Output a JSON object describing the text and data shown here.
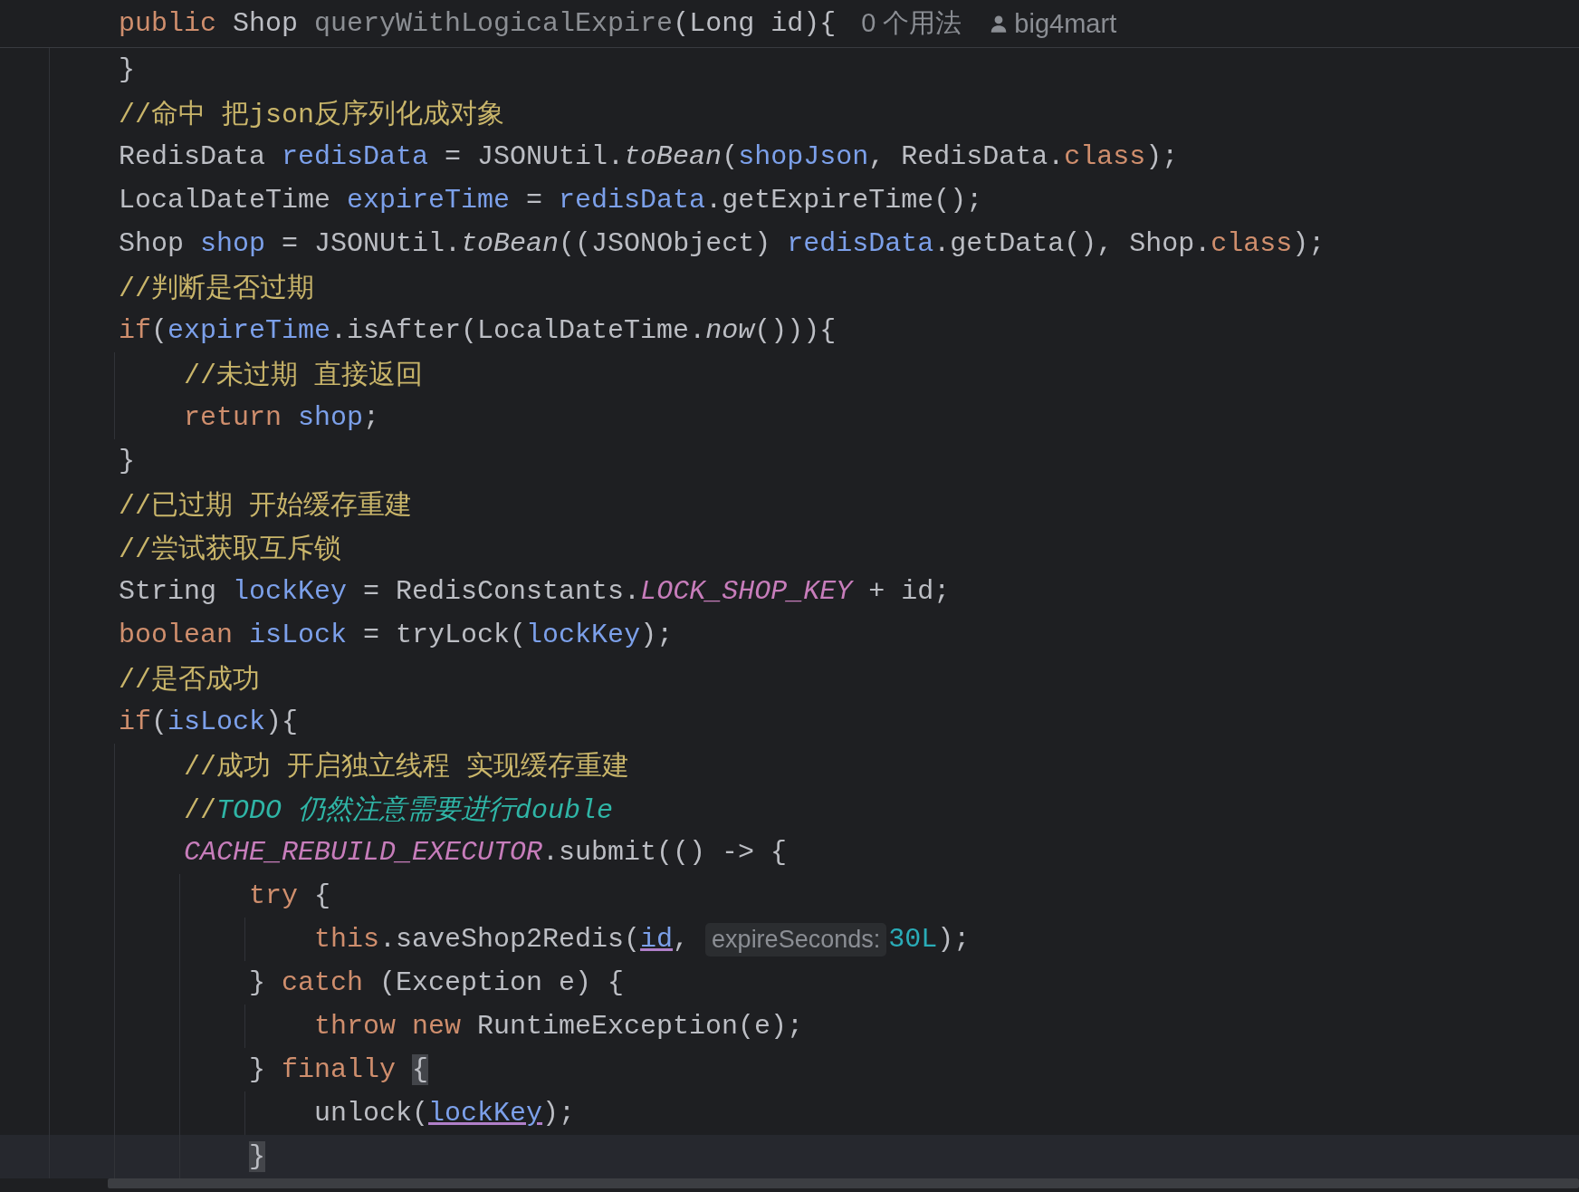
{
  "header": {
    "tokens": [
      {
        "kind": "keyword",
        "text": "public"
      },
      {
        "kind": "plain",
        "text": " Shop "
      },
      {
        "kind": "dim",
        "text": "queryWithLogicalExpire"
      },
      {
        "kind": "plain",
        "text": "(Long id){"
      }
    ],
    "usages": "0 个用法",
    "author": "big4mart"
  },
  "lines": [
    {
      "current": false,
      "tokens": [
        {
          "kind": "plain",
          "text": "}"
        }
      ]
    },
    {
      "current": false,
      "tokens": [
        {
          "kind": "comment",
          "text": "//命中 把json反序列化成对象"
        }
      ]
    },
    {
      "current": false,
      "tokens": [
        {
          "kind": "plain",
          "text": "RedisData "
        },
        {
          "kind": "variable",
          "text": "redisData"
        },
        {
          "kind": "plain",
          "text": " = JSONUtil."
        },
        {
          "kind": "static-call",
          "text": "toBean"
        },
        {
          "kind": "plain",
          "text": "("
        },
        {
          "kind": "variable",
          "text": "shopJson"
        },
        {
          "kind": "plain",
          "text": ", RedisData."
        },
        {
          "kind": "keyword",
          "text": "class"
        },
        {
          "kind": "plain",
          "text": ");"
        }
      ]
    },
    {
      "current": false,
      "tokens": [
        {
          "kind": "plain",
          "text": "LocalDateTime "
        },
        {
          "kind": "variable",
          "text": "expireTime"
        },
        {
          "kind": "plain",
          "text": " = "
        },
        {
          "kind": "variable",
          "text": "redisData"
        },
        {
          "kind": "plain",
          "text": ".getExpireTime();"
        }
      ]
    },
    {
      "current": false,
      "tokens": [
        {
          "kind": "plain",
          "text": "Shop "
        },
        {
          "kind": "variable",
          "text": "shop"
        },
        {
          "kind": "plain",
          "text": " = JSONUtil."
        },
        {
          "kind": "static-call",
          "text": "toBean"
        },
        {
          "kind": "plain",
          "text": "((JSONObject) "
        },
        {
          "kind": "variable",
          "text": "redisData"
        },
        {
          "kind": "plain",
          "text": ".getData(), Shop."
        },
        {
          "kind": "keyword",
          "text": "class"
        },
        {
          "kind": "plain",
          "text": ");"
        }
      ]
    },
    {
      "current": false,
      "tokens": [
        {
          "kind": "comment",
          "text": "//判断是否过期"
        }
      ]
    },
    {
      "current": false,
      "tokens": [
        {
          "kind": "keyword",
          "text": "if"
        },
        {
          "kind": "plain",
          "text": "("
        },
        {
          "kind": "variable",
          "text": "expireTime"
        },
        {
          "kind": "plain",
          "text": ".isAfter(LocalDateTime."
        },
        {
          "kind": "static-call",
          "text": "now"
        },
        {
          "kind": "plain",
          "text": "())){"
        }
      ],
      "children": [
        {
          "current": false,
          "tokens": [
            {
              "kind": "comment",
              "text": "//未过期 直接返回"
            }
          ]
        },
        {
          "current": false,
          "tokens": [
            {
              "kind": "keyword",
              "text": "return "
            },
            {
              "kind": "variable",
              "text": "shop"
            },
            {
              "kind": "plain",
              "text": ";"
            }
          ]
        }
      ]
    },
    {
      "current": false,
      "tokens": [
        {
          "kind": "plain",
          "text": "}"
        }
      ]
    },
    {
      "current": false,
      "tokens": [
        {
          "kind": "comment",
          "text": "//已过期 开始缓存重建"
        }
      ]
    },
    {
      "current": false,
      "tokens": [
        {
          "kind": "comment",
          "text": "//尝试获取互斥锁"
        }
      ]
    },
    {
      "current": false,
      "tokens": [
        {
          "kind": "plain",
          "text": "String "
        },
        {
          "kind": "variable",
          "text": "lockKey"
        },
        {
          "kind": "plain",
          "text": " = RedisConstants."
        },
        {
          "kind": "constant",
          "text": "LOCK_SHOP_KEY"
        },
        {
          "kind": "plain",
          "text": " + id;"
        }
      ]
    },
    {
      "current": false,
      "tokens": [
        {
          "kind": "keyword",
          "text": "boolean "
        },
        {
          "kind": "variable",
          "text": "isLock"
        },
        {
          "kind": "plain",
          "text": " = tryLock("
        },
        {
          "kind": "variable",
          "text": "lockKey"
        },
        {
          "kind": "plain",
          "text": ");"
        }
      ]
    },
    {
      "current": false,
      "tokens": [
        {
          "kind": "comment",
          "text": "//是否成功"
        }
      ]
    },
    {
      "current": false,
      "tokens": [
        {
          "kind": "keyword",
          "text": "if"
        },
        {
          "kind": "plain",
          "text": "("
        },
        {
          "kind": "variable",
          "text": "isLock"
        },
        {
          "kind": "plain",
          "text": "){"
        }
      ],
      "children": [
        {
          "current": false,
          "tokens": [
            {
              "kind": "comment",
              "text": "//成功 开启独立线程 实现缓存重建"
            }
          ]
        },
        {
          "current": false,
          "tokens": [
            {
              "kind": "comment",
              "text": "//"
            },
            {
              "kind": "todo",
              "text": "TODO 仍然注意需要进行double"
            }
          ]
        },
        {
          "current": false,
          "tokens": [
            {
              "kind": "constant",
              "text": "CACHE_REBUILD_EXECUTOR"
            },
            {
              "kind": "plain",
              "text": ".submit(() -> {"
            }
          ],
          "children": [
            {
              "current": false,
              "tokens": [
                {
                  "kind": "keyword",
                  "text": "try"
                },
                {
                  "kind": "plain",
                  "text": " {"
                }
              ],
              "children": [
                {
                  "current": false,
                  "tokens": [
                    {
                      "kind": "keyword",
                      "text": "this"
                    },
                    {
                      "kind": "plain",
                      "text": ".saveShop2Redis("
                    },
                    {
                      "kind": "captured",
                      "text": "id"
                    },
                    {
                      "kind": "plain",
                      "text": ", "
                    },
                    {
                      "kind": "hint",
                      "text": "expireSeconds:"
                    },
                    {
                      "kind": "number",
                      "text": "30L"
                    },
                    {
                      "kind": "plain",
                      "text": ");"
                    }
                  ]
                }
              ]
            },
            {
              "current": false,
              "tokens": [
                {
                  "kind": "plain",
                  "text": "} "
                },
                {
                  "kind": "keyword",
                  "text": "catch"
                },
                {
                  "kind": "plain",
                  "text": " (Exception e) {"
                }
              ],
              "children": [
                {
                  "current": false,
                  "tokens": [
                    {
                      "kind": "keyword",
                      "text": "throw new "
                    },
                    {
                      "kind": "plain",
                      "text": "RuntimeException(e);"
                    }
                  ]
                }
              ]
            },
            {
              "current": false,
              "tokens": [
                {
                  "kind": "plain",
                  "text": "} "
                },
                {
                  "kind": "keyword",
                  "text": "finally "
                },
                {
                  "kind": "brace-match",
                  "text": "{"
                }
              ],
              "children": [
                {
                  "current": false,
                  "tokens": [
                    {
                      "kind": "plain",
                      "text": "unlock("
                    },
                    {
                      "kind": "captured",
                      "text": "lockKey"
                    },
                    {
                      "kind": "plain",
                      "text": ");"
                    }
                  ]
                }
              ]
            },
            {
              "current": true,
              "tokens": [
                {
                  "kind": "brace-match",
                  "text": "}"
                }
              ]
            }
          ]
        }
      ]
    }
  ]
}
